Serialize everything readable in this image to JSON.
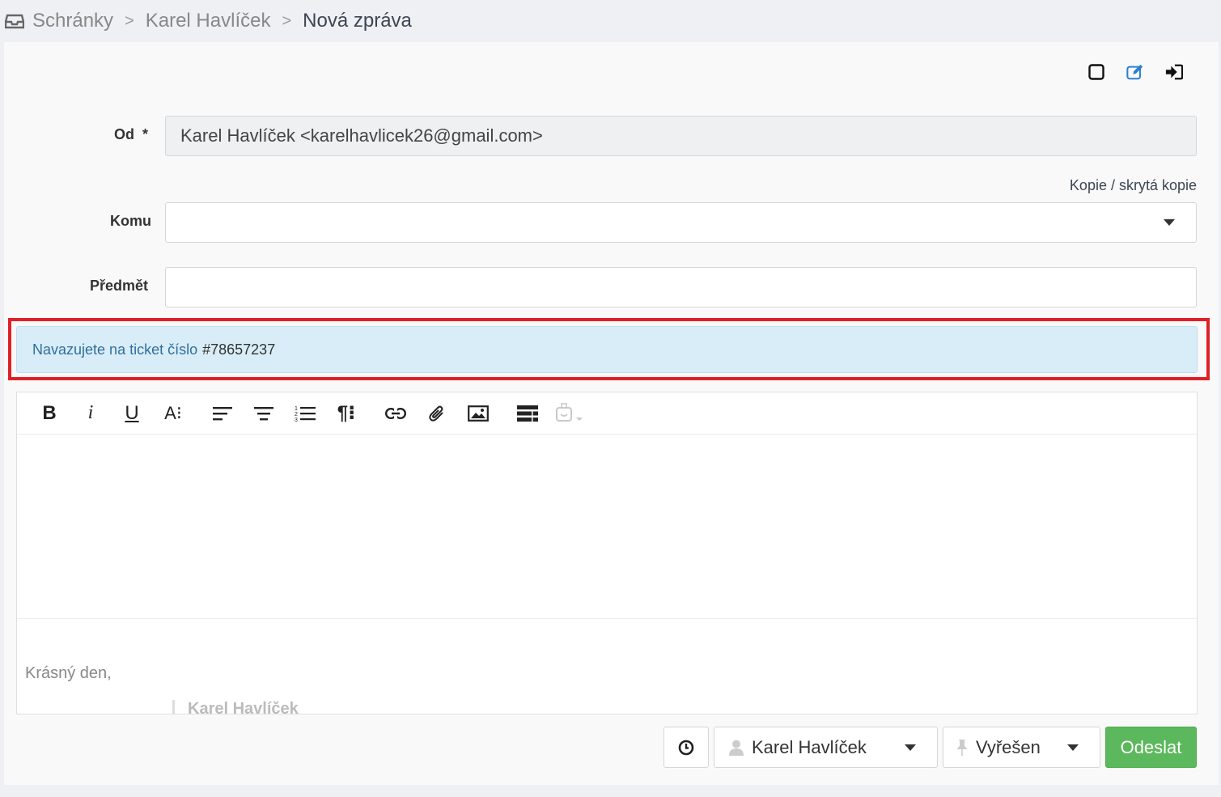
{
  "breadcrumb": {
    "icon": "inbox-icon",
    "items": [
      "Schránky",
      "Karel Havlíček",
      "Nová zpráva"
    ],
    "separator": ">"
  },
  "top_actions": [
    {
      "name": "checkbox-square-icon"
    },
    {
      "name": "edit-icon",
      "color": "#2a7fd4"
    },
    {
      "name": "sign-in-icon"
    }
  ],
  "form": {
    "from": {
      "label": "Od",
      "required_mark": "*",
      "value": "Karel Havlíček <karelhavlicek26@gmail.com>"
    },
    "cc_link": "Kopie / skrytá kopie",
    "to": {
      "label": "Komu",
      "value": ""
    },
    "subject": {
      "label": "Předmět",
      "value": ""
    }
  },
  "alert": {
    "text": "Navazujete na ticket číslo",
    "ticket": "#78657237",
    "highlight_color": "#e02027"
  },
  "editor": {
    "toolbar": [
      {
        "name": "bold-button",
        "glyph": "B"
      },
      {
        "name": "italic-button",
        "glyph": "i"
      },
      {
        "name": "underline-button",
        "glyph": "U"
      },
      {
        "name": "font-size-button",
        "glyph": "A⁝"
      },
      {
        "name": "align-left-button"
      },
      {
        "name": "align-center-button"
      },
      {
        "name": "ordered-list-button"
      },
      {
        "name": "paragraph-button",
        "glyph": "¶⁝"
      },
      {
        "name": "link-button"
      },
      {
        "name": "attachment-button"
      },
      {
        "name": "image-button"
      },
      {
        "name": "table-button"
      },
      {
        "name": "template-button"
      }
    ],
    "signature_greeting": "Krásný den,",
    "signature_name": "Karel Havlíček"
  },
  "footer": {
    "owner": "Karel Havlíček",
    "status": "Vyřešen",
    "send_label": "Odeslat",
    "send_color": "#5cb85c"
  }
}
